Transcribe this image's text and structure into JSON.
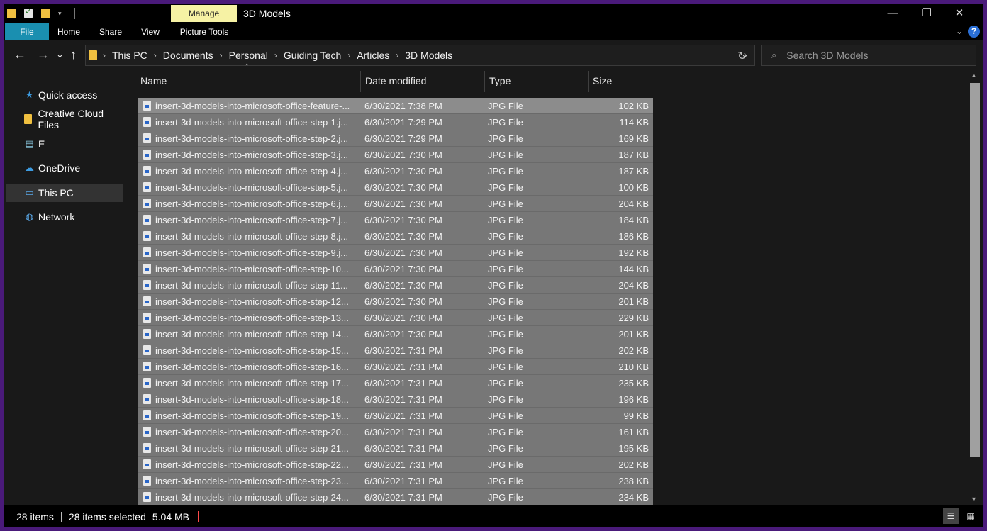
{
  "window": {
    "title": "3D Models"
  },
  "titlebar": {
    "manage_label": "Manage",
    "minimize": "—",
    "restore": "❐",
    "close": "✕"
  },
  "ribbon": {
    "tabs": [
      "File",
      "Home",
      "Share",
      "View",
      "Picture Tools"
    ],
    "help": "?",
    "expand": "⌄"
  },
  "nav": {
    "back": "←",
    "forward": "→",
    "recent": "⌄",
    "up": "↑",
    "breadcrumbs": [
      "This PC",
      "Documents",
      "Personal",
      "Guiding Tech",
      "Articles",
      "3D Models"
    ],
    "separator": "›",
    "refresh": "↻",
    "dropdown": "⌄",
    "search_placeholder": "Search 3D Models"
  },
  "sidebar": {
    "items": [
      {
        "label": "Quick access",
        "icon": "star-icon"
      },
      {
        "label": "Creative Cloud Files",
        "icon": "folder-icon"
      },
      {
        "label": "E",
        "icon": "drive-icon"
      },
      {
        "label": "OneDrive",
        "icon": "cloud-icon"
      },
      {
        "label": "This PC",
        "icon": "computer-icon"
      },
      {
        "label": "Network",
        "icon": "network-icon"
      }
    ]
  },
  "columns": {
    "name": "Name",
    "date": "Date modified",
    "type": "Type",
    "size": "Size"
  },
  "files": [
    {
      "name": "insert-3d-models-into-microsoft-office-feature-...",
      "date": "6/30/2021 7:38 PM",
      "type": "JPG File",
      "size": "102 KB"
    },
    {
      "name": "insert-3d-models-into-microsoft-office-step-1.j...",
      "date": "6/30/2021 7:29 PM",
      "type": "JPG File",
      "size": "114 KB"
    },
    {
      "name": "insert-3d-models-into-microsoft-office-step-2.j...",
      "date": "6/30/2021 7:29 PM",
      "type": "JPG File",
      "size": "169 KB"
    },
    {
      "name": "insert-3d-models-into-microsoft-office-step-3.j...",
      "date": "6/30/2021 7:30 PM",
      "type": "JPG File",
      "size": "187 KB"
    },
    {
      "name": "insert-3d-models-into-microsoft-office-step-4.j...",
      "date": "6/30/2021 7:30 PM",
      "type": "JPG File",
      "size": "187 KB"
    },
    {
      "name": "insert-3d-models-into-microsoft-office-step-5.j...",
      "date": "6/30/2021 7:30 PM",
      "type": "JPG File",
      "size": "100 KB"
    },
    {
      "name": "insert-3d-models-into-microsoft-office-step-6.j...",
      "date": "6/30/2021 7:30 PM",
      "type": "JPG File",
      "size": "204 KB"
    },
    {
      "name": "insert-3d-models-into-microsoft-office-step-7.j...",
      "date": "6/30/2021 7:30 PM",
      "type": "JPG File",
      "size": "184 KB"
    },
    {
      "name": "insert-3d-models-into-microsoft-office-step-8.j...",
      "date": "6/30/2021 7:30 PM",
      "type": "JPG File",
      "size": "186 KB"
    },
    {
      "name": "insert-3d-models-into-microsoft-office-step-9.j...",
      "date": "6/30/2021 7:30 PM",
      "type": "JPG File",
      "size": "192 KB"
    },
    {
      "name": "insert-3d-models-into-microsoft-office-step-10...",
      "date": "6/30/2021 7:30 PM",
      "type": "JPG File",
      "size": "144 KB"
    },
    {
      "name": "insert-3d-models-into-microsoft-office-step-11...",
      "date": "6/30/2021 7:30 PM",
      "type": "JPG File",
      "size": "204 KB"
    },
    {
      "name": "insert-3d-models-into-microsoft-office-step-12...",
      "date": "6/30/2021 7:30 PM",
      "type": "JPG File",
      "size": "201 KB"
    },
    {
      "name": "insert-3d-models-into-microsoft-office-step-13...",
      "date": "6/30/2021 7:30 PM",
      "type": "JPG File",
      "size": "229 KB"
    },
    {
      "name": "insert-3d-models-into-microsoft-office-step-14...",
      "date": "6/30/2021 7:30 PM",
      "type": "JPG File",
      "size": "201 KB"
    },
    {
      "name": "insert-3d-models-into-microsoft-office-step-15...",
      "date": "6/30/2021 7:31 PM",
      "type": "JPG File",
      "size": "202 KB"
    },
    {
      "name": "insert-3d-models-into-microsoft-office-step-16...",
      "date": "6/30/2021 7:31 PM",
      "type": "JPG File",
      "size": "210 KB"
    },
    {
      "name": "insert-3d-models-into-microsoft-office-step-17...",
      "date": "6/30/2021 7:31 PM",
      "type": "JPG File",
      "size": "235 KB"
    },
    {
      "name": "insert-3d-models-into-microsoft-office-step-18...",
      "date": "6/30/2021 7:31 PM",
      "type": "JPG File",
      "size": "196 KB"
    },
    {
      "name": "insert-3d-models-into-microsoft-office-step-19...",
      "date": "6/30/2021 7:31 PM",
      "type": "JPG File",
      "size": "99 KB"
    },
    {
      "name": "insert-3d-models-into-microsoft-office-step-20...",
      "date": "6/30/2021 7:31 PM",
      "type": "JPG File",
      "size": "161 KB"
    },
    {
      "name": "insert-3d-models-into-microsoft-office-step-21...",
      "date": "6/30/2021 7:31 PM",
      "type": "JPG File",
      "size": "195 KB"
    },
    {
      "name": "insert-3d-models-into-microsoft-office-step-22...",
      "date": "6/30/2021 7:31 PM",
      "type": "JPG File",
      "size": "202 KB"
    },
    {
      "name": "insert-3d-models-into-microsoft-office-step-23...",
      "date": "6/30/2021 7:31 PM",
      "type": "JPG File",
      "size": "238 KB"
    },
    {
      "name": "insert-3d-models-into-microsoft-office-step-24...",
      "date": "6/30/2021 7:31 PM",
      "type": "JPG File",
      "size": "234 KB"
    }
  ],
  "status": {
    "items": "28 items",
    "selected": "28 items selected",
    "size": "5.04 MB"
  },
  "colors": {
    "selection": "#777777",
    "selection_focus": "#8c8c8c",
    "manage_tab": "#f6f2a4",
    "file_tab": "#1a8fb0",
    "background": "#191919",
    "frame": "#4a1a7a"
  }
}
